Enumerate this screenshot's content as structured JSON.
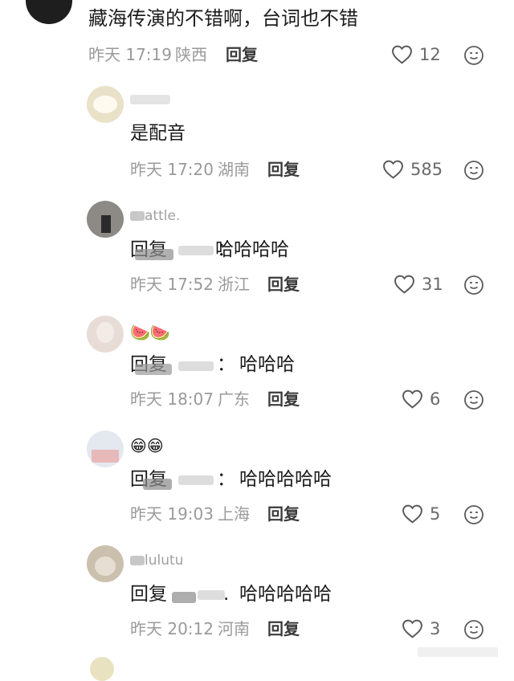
{
  "top_comment": {
    "text": "藏海传演的不错啊，台词也不错",
    "time": "昨天 17:19",
    "location": "陕西",
    "reply_label": "回复",
    "likes": "12"
  },
  "replies": [
    {
      "username": "",
      "text": "是配音",
      "time": "昨天 17:20",
      "location": "湖南",
      "reply_label": "回复",
      "likes": "585"
    },
    {
      "username": "attle.",
      "reply_prefix": "回复",
      "reply_target": "",
      "text": "哈哈哈哈",
      "time": "昨天 17:52",
      "location": "浙江",
      "reply_label": "回复",
      "likes": "31"
    },
    {
      "username_emoji": "🍉🍉",
      "reply_prefix": "回复",
      "reply_target": "",
      "text": "哈哈哈",
      "time": "昨天 18:07",
      "location": "广东",
      "reply_label": "回复",
      "likes": "6"
    },
    {
      "username_emoji": "😁😁",
      "reply_prefix": "回复",
      "reply_target": "",
      "text": "哈哈哈哈哈",
      "time": "昨天 19:03",
      "location": "上海",
      "reply_label": "回复",
      "likes": "5"
    },
    {
      "username": "lulutu",
      "reply_prefix": "回复",
      "reply_target": "",
      "text": "哈哈哈哈哈",
      "time": "昨天 20:12",
      "location": "河南",
      "reply_label": "回复",
      "likes": "3"
    }
  ],
  "icons": {
    "like": "heart-outline-icon",
    "face": "smiley-face-icon"
  }
}
